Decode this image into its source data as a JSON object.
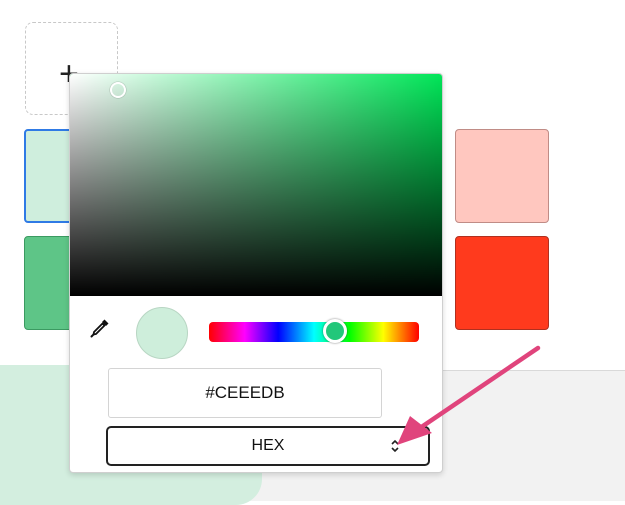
{
  "add_tile": {
    "icon": "plus-icon",
    "glyph": "+"
  },
  "swatches": {
    "selected": {
      "color": "#CEEEDB",
      "border": "#2F7AE5"
    },
    "green": {
      "color": "#5EC587"
    },
    "pink": {
      "color": "#FFC7BF"
    },
    "red": {
      "color": "#FF3A1D"
    }
  },
  "picker": {
    "value": "#CEEEDB",
    "format_selected": "HEX",
    "hue_color": "#00E658",
    "eyedropper_icon": "eyedropper-icon",
    "select_icon": "chevron-updown-icon"
  },
  "annotation": {
    "arrow_color": "#E0447C"
  }
}
